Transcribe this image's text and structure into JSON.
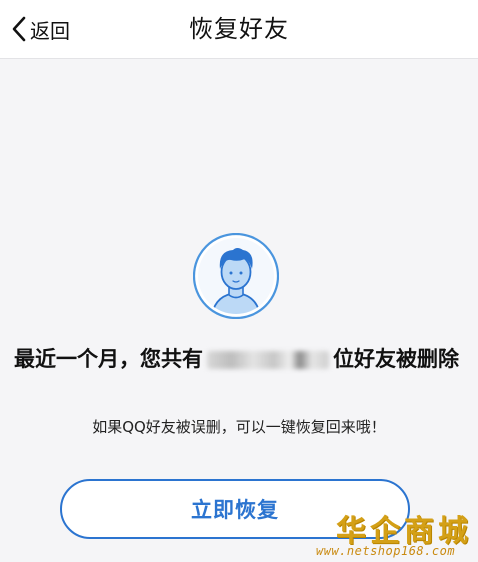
{
  "header": {
    "back_label": "返回",
    "title": "恢复好友"
  },
  "icons": {
    "back": "chevron-left-icon",
    "avatar": "user-avatar-icon"
  },
  "colors": {
    "accent": "#2b74d0",
    "avatar_ring": "#4a95de",
    "background": "#f5f5f7"
  },
  "main": {
    "headline_prefix": "最近一个月，您共有",
    "headline_suffix": "位好友被删除",
    "subline": "如果QQ好友被误删，可以一键恢复回来哦！",
    "restore_button": "立即恢复"
  },
  "watermark": {
    "title": "华企商城",
    "url": "www.netshop168.com"
  }
}
